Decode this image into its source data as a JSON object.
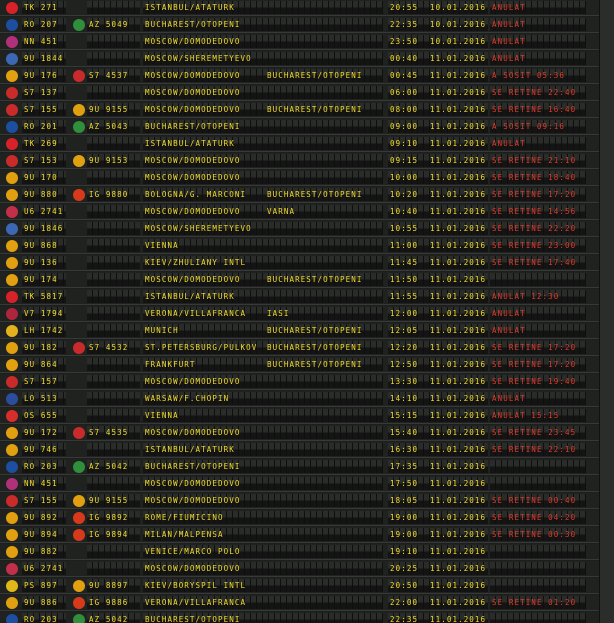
{
  "rows": [
    {
      "logo": "turkish-airlines-icon",
      "color": "#d8222a",
      "f1": "TK 271",
      "f2": "",
      "logo2": "",
      "color2": "",
      "dest1": "ISTANBUL/ATATURK",
      "dest2": "",
      "time": "20:55",
      "date": "10.01.2016",
      "status": "ANULAT"
    },
    {
      "logo": "tarom-icon",
      "color": "#1c4fa0",
      "f1": "RO 207",
      "f2": "AZ 5049",
      "logo2": "alitalia-icon",
      "color2": "#2f8f3a",
      "dest1": "BUCHAREST/OTOPENI",
      "dest2": "",
      "time": "22:35",
      "date": "10.01.2016",
      "status": "ANULAT"
    },
    {
      "logo": "nordwind-icon",
      "color": "#b0317a",
      "f1": "NN 451",
      "f2": "",
      "logo2": "",
      "color2": "",
      "dest1": "MOSCOW/DOMODEDOVO",
      "dest2": "",
      "time": "23:50",
      "date": "10.01.2016",
      "status": "ANULAT"
    },
    {
      "logo": "aeroflot-icon",
      "color": "#3c67b5",
      "f1": "9U 1844",
      "f2": "",
      "logo2": "",
      "color2": "",
      "dest1": "MOSCOW/SHEREMETYEVO",
      "dest2": "",
      "time": "00:40",
      "date": "11.01.2016",
      "status": "ANULAT"
    },
    {
      "logo": "air-moldova-icon",
      "color": "#e0a010",
      "f1": "9U 176",
      "f2": "S7 4537",
      "logo2": "s7-icon",
      "color2": "#c92a2a",
      "dest1": "MOSCOW/DOMODEDOVO",
      "dest2": "BUCHAREST/OTOPENI",
      "time": "00:45",
      "date": "11.01.2016",
      "status": "A SOSIT 05:36"
    },
    {
      "logo": "s7-icon",
      "color": "#c92a2a",
      "f1": "S7 137",
      "f2": "",
      "logo2": "",
      "color2": "",
      "dest1": "MOSCOW/DOMODEDOVO",
      "dest2": "",
      "time": "06:00",
      "date": "11.01.2016",
      "status": "SE RETINE 22:40"
    },
    {
      "logo": "s7-icon",
      "color": "#c92a2a",
      "f1": "S7 155",
      "f2": "9U 9155",
      "logo2": "air-moldova-icon",
      "color2": "#e0a010",
      "dest1": "MOSCOW/DOMODEDOVO",
      "dest2": "BUCHAREST/OTOPENI",
      "time": "08:00",
      "date": "11.01.2016",
      "status": "SE RETINE 16:40"
    },
    {
      "logo": "tarom-icon",
      "color": "#1c4fa0",
      "f1": "RO 201",
      "f2": "AZ 5043",
      "logo2": "alitalia-icon",
      "color2": "#2f8f3a",
      "dest1": "BUCHAREST/OTOPENI",
      "dest2": "",
      "time": "09:00",
      "date": "11.01.2016",
      "status": "A SOSIT 09:16"
    },
    {
      "logo": "turkish-airlines-icon",
      "color": "#d8222a",
      "f1": "TK 269",
      "f2": "",
      "logo2": "",
      "color2": "",
      "dest1": "ISTANBUL/ATATURK",
      "dest2": "",
      "time": "09:10",
      "date": "11.01.2016",
      "status": "ANULAT"
    },
    {
      "logo": "s7-icon",
      "color": "#c92a2a",
      "f1": "S7 153",
      "f2": "9U 9153",
      "logo2": "air-moldova-icon",
      "color2": "#e0a010",
      "dest1": "MOSCOW/DOMODEDOVO",
      "dest2": "",
      "time": "09:15",
      "date": "11.01.2016",
      "status": "SE RETINE 21:10"
    },
    {
      "logo": "air-moldova-icon",
      "color": "#e0a010",
      "f1": "9U 170",
      "f2": "",
      "logo2": "",
      "color2": "",
      "dest1": "MOSCOW/DOMODEDOVO",
      "dest2": "",
      "time": "10:00",
      "date": "11.01.2016",
      "status": "SE RETINE 18:40"
    },
    {
      "logo": "air-moldova-icon",
      "color": "#e0a010",
      "f1": "9U 880",
      "f2": "IG 9880",
      "logo2": "meridiana-icon",
      "color2": "#d73a1a",
      "dest1": "BOLOGNA/G. MARCONI",
      "dest2": "BUCHAREST/OTOPENI",
      "time": "10:20",
      "date": "11.01.2016",
      "status": "SE RETINE 17:20"
    },
    {
      "logo": "ural-icon",
      "color": "#c22f4a",
      "f1": "U6 2741",
      "f2": "",
      "logo2": "",
      "color2": "",
      "dest1": "MOSCOW/DOMODEDOVO",
      "dest2": "VARNA",
      "time": "10:40",
      "date": "11.01.2016",
      "status": "SE RETINE 14:56"
    },
    {
      "logo": "aeroflot-icon",
      "color": "#3c67b5",
      "f1": "9U 1846",
      "f2": "",
      "logo2": "",
      "color2": "",
      "dest1": "MOSCOW/SHEREMETYEVO",
      "dest2": "",
      "time": "10:55",
      "date": "11.01.2016",
      "status": "SE RETINE 22:20"
    },
    {
      "logo": "air-moldova-icon",
      "color": "#e0a010",
      "f1": "9U 868",
      "f2": "",
      "logo2": "",
      "color2": "",
      "dest1": "VIENNA",
      "dest2": "",
      "time": "11:00",
      "date": "11.01.2016",
      "status": "SE RETINE 23:00"
    },
    {
      "logo": "air-moldova-icon",
      "color": "#e0a010",
      "f1": "9U 136",
      "f2": "",
      "logo2": "",
      "color2": "",
      "dest1": "KIEV/ZHULIANY INTL",
      "dest2": "",
      "time": "11:45",
      "date": "11.01.2016",
      "status": "SE RETINE 17:40"
    },
    {
      "logo": "air-moldova-icon",
      "color": "#e0a010",
      "f1": "9U 174",
      "f2": "",
      "logo2": "",
      "color2": "",
      "dest1": "MOSCOW/DOMODEDOVO",
      "dest2": "BUCHAREST/OTOPENI",
      "time": "11:50",
      "date": "11.01.2016",
      "status": ""
    },
    {
      "logo": "turkish-airlines-icon",
      "color": "#d8222a",
      "f1": "TK 5817",
      "f2": "",
      "logo2": "",
      "color2": "",
      "dest1": "ISTANBUL/ATATURK",
      "dest2": "",
      "time": "11:55",
      "date": "11.01.2016",
      "status": "ANULAT 12:30"
    },
    {
      "logo": "volotea-icon",
      "color": "#b0253e",
      "f1": "V7 1794",
      "f2": "",
      "logo2": "",
      "color2": "",
      "dest1": "VERONA/VILLAFRANCA",
      "dest2": "IASI",
      "time": "12:00",
      "date": "11.01.2016",
      "status": "ANULAT"
    },
    {
      "logo": "lufthansa-icon",
      "color": "#e3b21c",
      "f1": "LH 1742",
      "f2": "",
      "logo2": "",
      "color2": "",
      "dest1": "MUNICH",
      "dest2": "BUCHAREST/OTOPENI",
      "time": "12:05",
      "date": "11.01.2016",
      "status": "ANULAT"
    },
    {
      "logo": "air-moldova-icon",
      "color": "#e0a010",
      "f1": "9U 182",
      "f2": "S7 4532",
      "logo2": "s7-icon",
      "color2": "#c92a2a",
      "dest1": "ST.PETERSBURG/PULKOV",
      "dest2": "BUCHAREST/OTOPENI",
      "time": "12:20",
      "date": "11.01.2016",
      "status": "SE RETINE 17:20"
    },
    {
      "logo": "air-moldova-icon",
      "color": "#e0a010",
      "f1": "9U 864",
      "f2": "",
      "logo2": "",
      "color2": "",
      "dest1": "FRANKFURT",
      "dest2": "BUCHAREST/OTOPENI",
      "time": "12:50",
      "date": "11.01.2016",
      "status": "SE RETINE 17:20"
    },
    {
      "logo": "s7-icon",
      "color": "#c92a2a",
      "f1": "S7 157",
      "f2": "",
      "logo2": "",
      "color2": "",
      "dest1": "MOSCOW/DOMODEDOVO",
      "dest2": "",
      "time": "13:30",
      "date": "11.01.2016",
      "status": "SE RETINE 19:40"
    },
    {
      "logo": "lot-icon",
      "color": "#2c4c9c",
      "f1": "LO 513",
      "f2": "",
      "logo2": "",
      "color2": "",
      "dest1": "WARSAW/F.CHOPIN",
      "dest2": "",
      "time": "14:10",
      "date": "11.01.2016",
      "status": "ANULAT"
    },
    {
      "logo": "austrian-icon",
      "color": "#d62d2d",
      "f1": "OS 655",
      "f2": "",
      "logo2": "",
      "color2": "",
      "dest1": "VIENNA",
      "dest2": "",
      "time": "15:15",
      "date": "11.01.2016",
      "status": "ANULAT 15:15"
    },
    {
      "logo": "air-moldova-icon",
      "color": "#e0a010",
      "f1": "9U 172",
      "f2": "S7 4535",
      "logo2": "s7-icon",
      "color2": "#c92a2a",
      "dest1": "MOSCOW/DOMODEDOVO",
      "dest2": "",
      "time": "15:40",
      "date": "11.01.2016",
      "status": "SE RETINE 23:45"
    },
    {
      "logo": "air-moldova-icon",
      "color": "#e0a010",
      "f1": "9U 746",
      "f2": "",
      "logo2": "",
      "color2": "",
      "dest1": "ISTANBUL/ATATURK",
      "dest2": "",
      "time": "16:30",
      "date": "11.01.2016",
      "status": "SE RETINE 22:10"
    },
    {
      "logo": "tarom-icon",
      "color": "#1c4fa0",
      "f1": "RO 203",
      "f2": "AZ 5042",
      "logo2": "alitalia-icon",
      "color2": "#2f8f3a",
      "dest1": "BUCHAREST/OTOPENI",
      "dest2": "",
      "time": "17:35",
      "date": "11.01.2016",
      "status": ""
    },
    {
      "logo": "nordwind-icon",
      "color": "#b0317a",
      "f1": "NN 451",
      "f2": "",
      "logo2": "",
      "color2": "",
      "dest1": "MOSCOW/DOMODEDOVO",
      "dest2": "",
      "time": "17:50",
      "date": "11.01.2016",
      "status": ""
    },
    {
      "logo": "s7-icon",
      "color": "#c92a2a",
      "f1": "S7 155",
      "f2": "9U 9155",
      "logo2": "air-moldova-icon",
      "color2": "#e0a010",
      "dest1": "MOSCOW/DOMODEDOVO",
      "dest2": "",
      "time": "18:05",
      "date": "11.01.2016",
      "status": "SE RETINE 00:40"
    },
    {
      "logo": "air-moldova-icon",
      "color": "#e0a010",
      "f1": "9U 892",
      "f2": "IG 9892",
      "logo2": "meridiana-icon",
      "color2": "#d73a1a",
      "dest1": "ROME/FIUMICINO",
      "dest2": "",
      "time": "19:00",
      "date": "11.01.2016",
      "status": "SE RETINE 04:20"
    },
    {
      "logo": "air-moldova-icon",
      "color": "#e0a010",
      "f1": "9U 894",
      "f2": "IG 9894",
      "logo2": "meridiana-icon",
      "color2": "#d73a1a",
      "dest1": "MILAN/MALPENSA",
      "dest2": "",
      "time": "19:00",
      "date": "11.01.2016",
      "status": "SE RETINE 00:30"
    },
    {
      "logo": "air-moldova-icon",
      "color": "#e0a010",
      "f1": "9U 882",
      "f2": "",
      "logo2": "",
      "color2": "",
      "dest1": "VENICE/MARCO POLO",
      "dest2": "",
      "time": "19:10",
      "date": "11.01.2016",
      "status": ""
    },
    {
      "logo": "ural-icon",
      "color": "#c22f4a",
      "f1": "U6 2741",
      "f2": "",
      "logo2": "",
      "color2": "",
      "dest1": "MOSCOW/DOMODEDOVO",
      "dest2": "",
      "time": "20:25",
      "date": "11.01.2016",
      "status": ""
    },
    {
      "logo": "ukraine-intl-icon",
      "color": "#e0b81a",
      "f1": "PS 897",
      "f2": "9U 8897",
      "logo2": "air-moldova-icon",
      "color2": "#e0a010",
      "dest1": "KIEV/BORYSPIL INTL",
      "dest2": "",
      "time": "20:50",
      "date": "11.01.2016",
      "status": ""
    },
    {
      "logo": "air-moldova-icon",
      "color": "#e0a010",
      "f1": "9U 886",
      "f2": "IG 9886",
      "logo2": "meridiana-icon",
      "color2": "#d73a1a",
      "dest1": "VERONA/VILLAFRANCA",
      "dest2": "",
      "time": "22:00",
      "date": "11.01.2016",
      "status": "SE RETINE 01:20"
    },
    {
      "logo": "tarom-icon",
      "color": "#1c4fa0",
      "f1": "RO 203",
      "f2": "AZ 5042",
      "logo2": "alitalia-icon",
      "color2": "#2f8f3a",
      "dest1": "BUCHAREST/OTOPENI",
      "dest2": "",
      "time": "22:35",
      "date": "11.01.2016",
      "status": ""
    }
  ]
}
